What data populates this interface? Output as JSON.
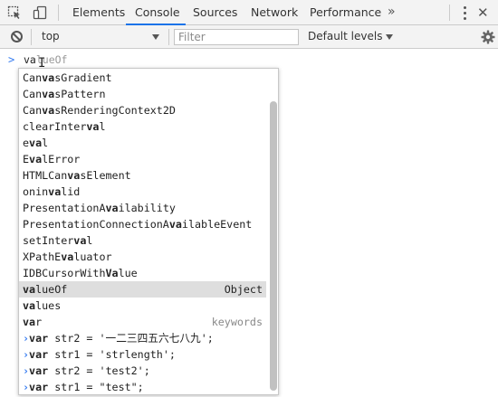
{
  "tabs": {
    "items": [
      "Elements",
      "Console",
      "Sources",
      "Network",
      "Performance"
    ],
    "active": "Console",
    "more_label": "»",
    "close_label": "✕"
  },
  "toolbar": {
    "context_value": "top",
    "filter_placeholder": "Filter",
    "filter_value": "",
    "levels_label": "Default levels"
  },
  "console": {
    "input_typed": "va",
    "input_completion": "lueOf"
  },
  "autocomplete": {
    "items": [
      {
        "pre": "Can",
        "match": "va",
        "post": "sGradient",
        "detail": ""
      },
      {
        "pre": "Can",
        "match": "va",
        "post": "sPattern",
        "detail": ""
      },
      {
        "pre": "Can",
        "match": "va",
        "post": "sRenderingContext2D",
        "detail": ""
      },
      {
        "pre": "clearInter",
        "match": "va",
        "post": "l",
        "detail": ""
      },
      {
        "pre": "e",
        "match": "va",
        "post": "l",
        "detail": ""
      },
      {
        "pre": "E",
        "match": "va",
        "post": "lError",
        "detail": ""
      },
      {
        "pre": "HTMLCan",
        "match": "va",
        "post": "sElement",
        "detail": ""
      },
      {
        "pre": "onin",
        "match": "va",
        "post": "lid",
        "detail": ""
      },
      {
        "pre": "PresentationA",
        "match": "va",
        "post": "ilability",
        "detail": ""
      },
      {
        "pre": "PresentationConnectionA",
        "match": "va",
        "post": "ilableEvent",
        "detail": ""
      },
      {
        "pre": "setInter",
        "match": "va",
        "post": "l",
        "detail": ""
      },
      {
        "pre": "XPathE",
        "match": "va",
        "post": "luator",
        "detail": ""
      },
      {
        "pre": "IDBCursorWith",
        "match": "Va",
        "post": "lue",
        "detail": ""
      },
      {
        "pre": "",
        "match": "va",
        "post": "lueOf",
        "detail": "Object",
        "selected": true
      },
      {
        "pre": "",
        "match": "va",
        "post": "lues",
        "detail": ""
      },
      {
        "pre": "",
        "match": "va",
        "post": "r",
        "detail": "keywords",
        "dim": true
      }
    ],
    "history": [
      {
        "match": "var",
        "post": " str2 = '一二三四五六七八九';"
      },
      {
        "match": "var",
        "post": " str1 = 'strlength';"
      },
      {
        "match": "var",
        "post": " str2 = 'test2';"
      },
      {
        "match": "var",
        "post": " str1 = \"test\";"
      }
    ],
    "history_prefix": "›"
  },
  "icons": {
    "inspect": "inspect-element-icon",
    "device": "device-toolbar-icon",
    "clear": "clear-console-icon",
    "settings": "gear-icon",
    "menu": "kebab-menu-icon"
  },
  "colors": {
    "accent": "#1a73e8",
    "prompt": "#367cf1",
    "selected_row": "#dedede"
  }
}
